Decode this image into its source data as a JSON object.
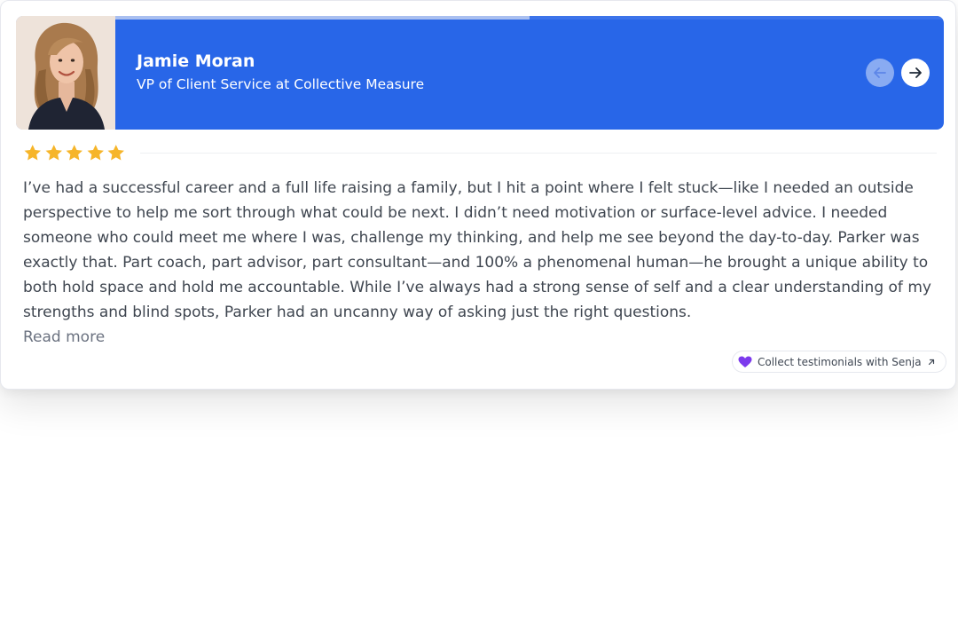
{
  "testimonial": {
    "author_name": "Jamie Moran",
    "author_title": "VP of Client Service at Collective Measure",
    "rating": 5,
    "rating_max": 5,
    "text": " I’ve had a successful career and a full life raising a family, but I hit a point where I felt stuck—like I needed an outside perspective to help me sort through what could be next. I didn’t need motivation or surface-level advice. I needed someone who could meet me where I was, challenge my thinking, and help me see beyond the day-to-day. Parker was exactly that. Part coach, part advisor, part consultant—and 100% a phenomenal human—he brought a unique ability to both hold space and hold me accountable. While I’ve always had a strong sense of self and a clear understanding of my strengths and blind spots, Parker had an uncanny way of asking just the right questions.",
    "read_more_label": "Read more"
  },
  "carousel": {
    "progress": 0.5,
    "prev_icon": "arrow-left-icon",
    "next_icon": "arrow-right-icon"
  },
  "branding": {
    "label": "Collect testimonials with Senja",
    "heart_icon": "heart-icon",
    "external_icon": "external-link-icon"
  },
  "colors": {
    "header_bg": "#2866e8",
    "star": "#f6b52a",
    "heart": "#7c3aed",
    "text": "#3f4650"
  }
}
